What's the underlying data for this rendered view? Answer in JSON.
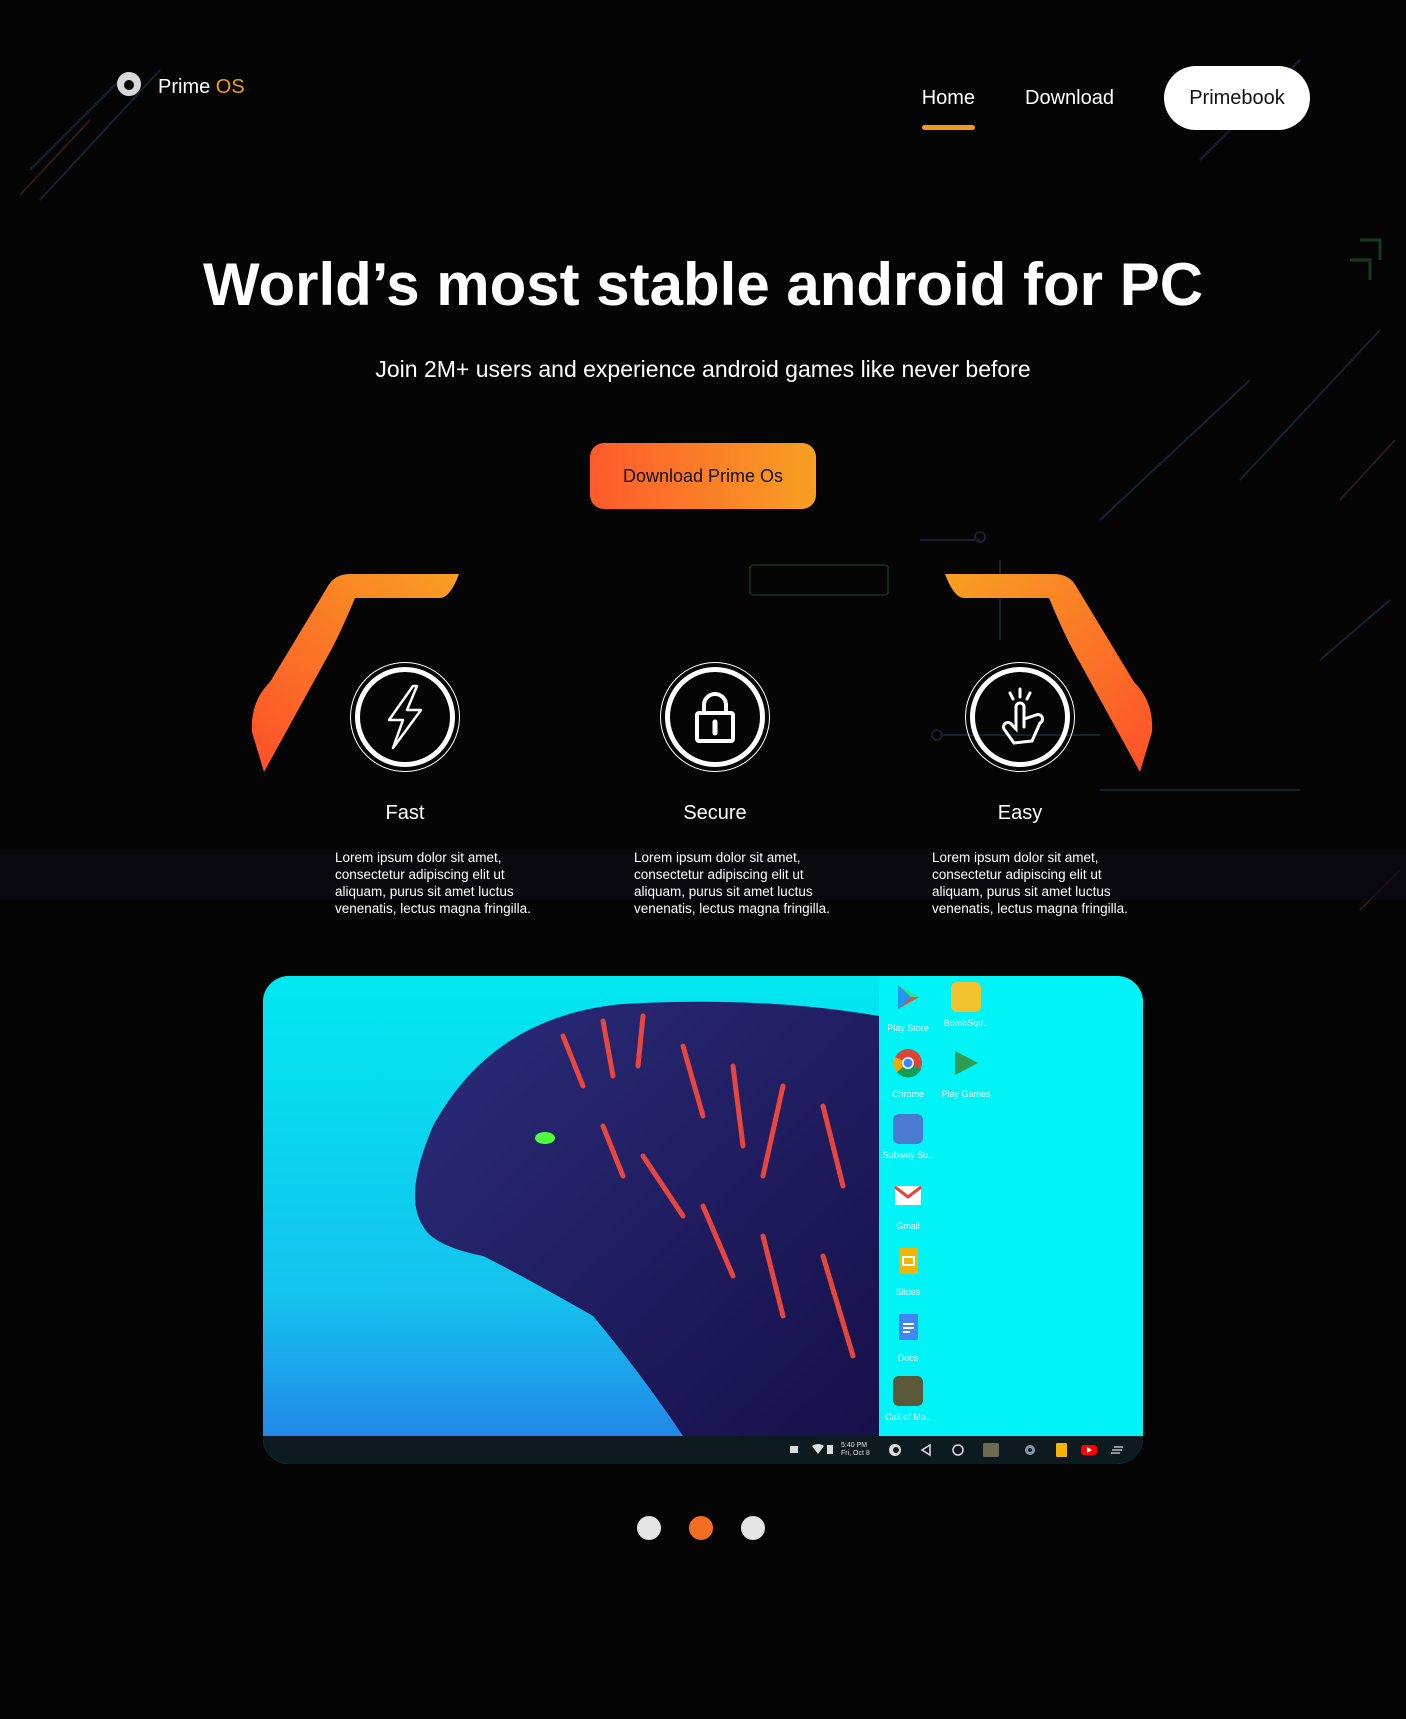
{
  "header": {
    "logo_text": "Prime",
    "logo_accent": "OS",
    "nav": {
      "home": "Home",
      "download": "Download",
      "primebook": "Primebook"
    }
  },
  "hero": {
    "title": "World’s most stable android for PC",
    "subtitle": "Join 2M+ users and experience android games like never before",
    "cta": "Download Prime Os"
  },
  "features": [
    {
      "title": "Fast",
      "icon": "lightning-icon",
      "text": "Lorem ipsum dolor sit amet, consectetur adipiscing elit ut aliquam, purus sit amet luctus venenatis, lectus magna fringilla."
    },
    {
      "title": "Secure",
      "icon": "lock-icon",
      "text": "Lorem ipsum dolor sit amet, consectetur adipiscing elit ut aliquam, purus sit amet luctus venenatis, lectus magna fringilla."
    },
    {
      "title": "Easy",
      "icon": "tap-hand-icon",
      "text": "Lorem ipsum dolor sit amet, consectetur adipiscing elit ut aliquam, purus sit amet luctus venenatis, lectus magna fringilla."
    }
  ],
  "screenshot": {
    "apps": [
      {
        "label": "Play Store",
        "color": "#3ddc84"
      },
      {
        "label": "BombSqu..",
        "color": "#f2c12e"
      },
      {
        "label": "Chrome",
        "color": "#db4437"
      },
      {
        "label": "Play Games",
        "color": "#2e9d51"
      },
      {
        "label": "Subway Su..",
        "color": "#4a7bd1"
      },
      {
        "label": "Gmail",
        "color": "#ffffff"
      },
      {
        "label": "Slides",
        "color": "#f4b400"
      },
      {
        "label": "Docs",
        "color": "#4285f4"
      },
      {
        "label": "Call of Mo..",
        "color": "#5a5a3a"
      }
    ],
    "clock_time": "5:40 PM",
    "clock_date": "Fri, Oct 8"
  },
  "carousel": {
    "total": 3,
    "active_index": 1
  },
  "colors": {
    "accent": "#f39a1c",
    "cta_start": "#ff5a2c",
    "cta_end": "#f7a022",
    "dot_active": "#f36d22"
  }
}
